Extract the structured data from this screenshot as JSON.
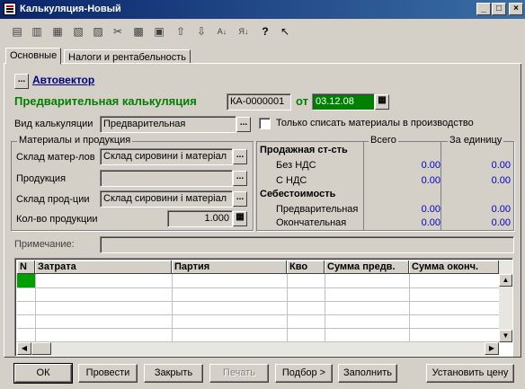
{
  "window": {
    "title": "Калькуляция-Новый",
    "controls": [
      "_",
      "□",
      "×"
    ]
  },
  "tabs": [
    {
      "label": "Основные"
    },
    {
      "label": "Налоги и рентабельность"
    }
  ],
  "header": {
    "autovector_btn": "...",
    "autovector_label": "Автовектор",
    "doc_title": "Предварительная калькуляция",
    "doc_number": "КА-0000001",
    "from_label": "от",
    "doc_date": "03.12.08"
  },
  "calc_type": {
    "label": "Вид калькуляции",
    "value": "Предварительная",
    "writeoff_label": "Только списать материалы в производство"
  },
  "materials": {
    "group_label": "Материалы и продукция",
    "warehouse_mat_label": "Склад матер-лов",
    "warehouse_mat_value": "Склад сировини і матеріал",
    "product_label": "Продукция",
    "product_value": "",
    "warehouse_prod_label": "Склад прод-ции",
    "warehouse_prod_value": "Склад сировини і матеріал",
    "qty_label": "Кол-во продукции",
    "qty_value": "1.000"
  },
  "summary": {
    "col_total": "Всего",
    "col_unit": "За единицу",
    "sale_header": "Продажная ст-сть",
    "no_vat_label": "Без НДС",
    "no_vat_total": "0.00",
    "no_vat_unit": "0.00",
    "vat_label": "С НДС",
    "vat_total": "0.00",
    "vat_unit": "0.00",
    "cost_header": "Себестоимость",
    "prelim_label": "Предварительная",
    "prelim_total": "0.00",
    "prelim_unit": "0.00",
    "final_label": "Окончательная",
    "final_total": "0.00",
    "final_unit": "0.00"
  },
  "note": {
    "label": "Примечание:",
    "value": ""
  },
  "table": {
    "columns": [
      "N",
      "Затрата",
      "Партия",
      "Кво",
      "Сумма предв.",
      "Сумма оконч."
    ],
    "rows": []
  },
  "buttons": {
    "ok": "ОК",
    "post": "Провести",
    "close": "Закрыть",
    "print": "Печать",
    "select": "Подбор >",
    "fill": "Заполнить",
    "set_price": "Установить цену"
  },
  "colors": {
    "title_start": "#0a246a",
    "title_end": "#3a6ea5",
    "doc_title": "#008000",
    "amounts": "#0000c0",
    "date_bg": "#008000"
  }
}
